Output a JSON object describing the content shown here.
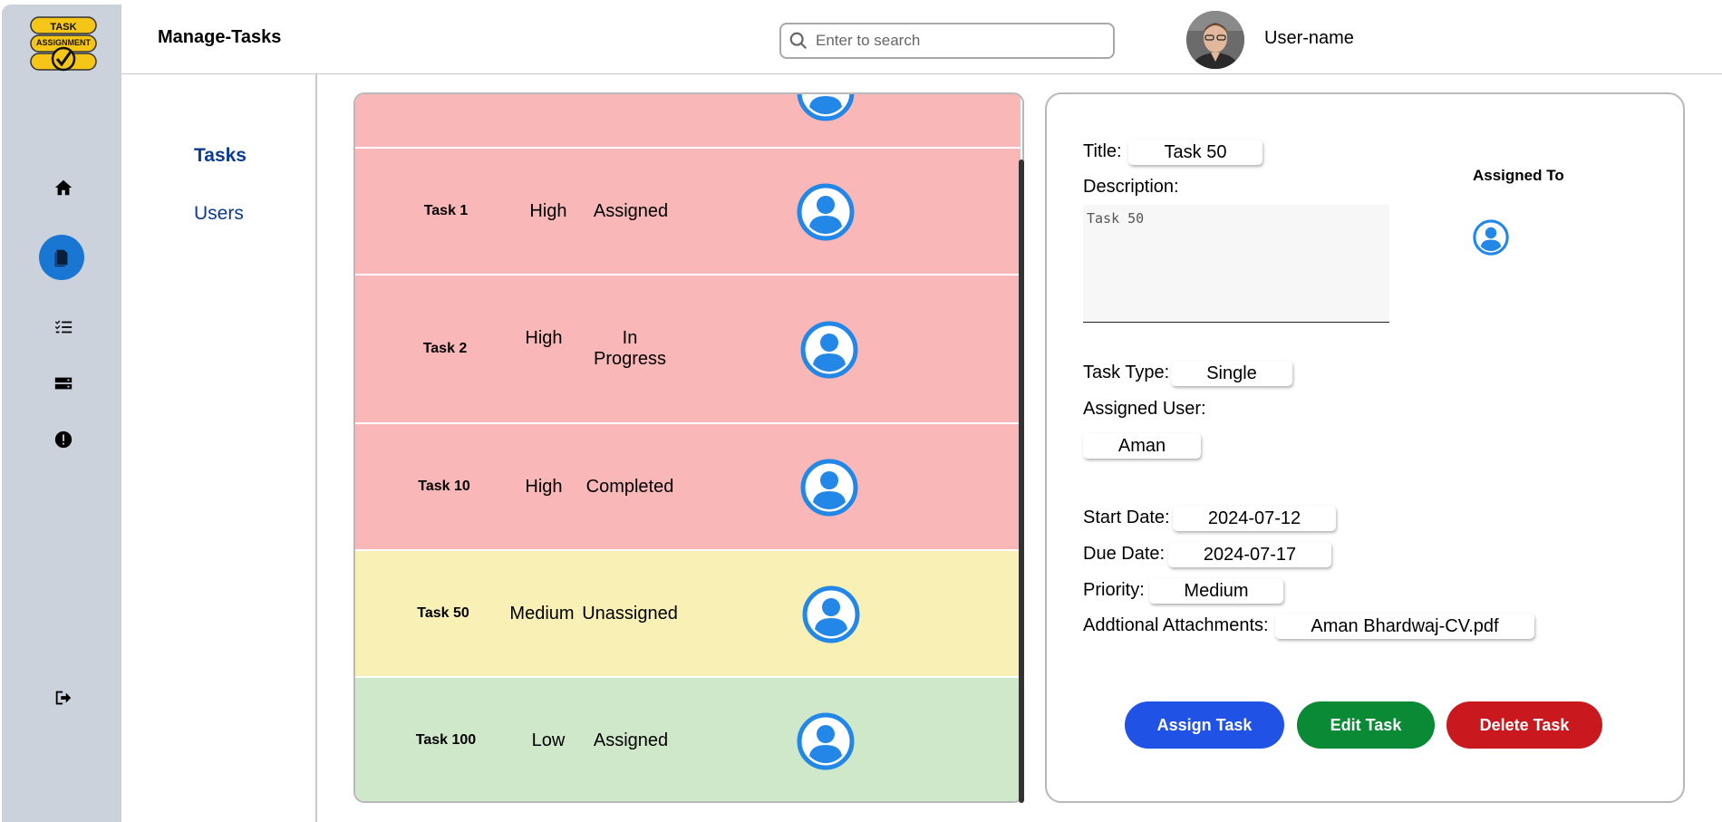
{
  "app": {
    "title": "Manage-Tasks",
    "logo_text": "TASK ASSIGNMENT"
  },
  "search": {
    "placeholder": "Enter to search",
    "value": ""
  },
  "user": {
    "name": "User-name"
  },
  "rail": {
    "icons": [
      "home-icon",
      "task-manage-icon",
      "checklist-icon",
      "storage-icon",
      "alert-icon",
      "logout-icon"
    ],
    "active": "task-manage-icon"
  },
  "subnav": {
    "items": [
      {
        "label": "Tasks",
        "active": true
      },
      {
        "label": "Users",
        "active": false
      }
    ]
  },
  "tasks": [
    {
      "name": "Task 1",
      "priority": "High",
      "status": "Assigned",
      "color": "#f9b7b7"
    },
    {
      "name": "Task 2",
      "priority": "High",
      "status": "In Progress",
      "color": "#f9b7b7"
    },
    {
      "name": "Task 10",
      "priority": "High",
      "status": "Completed",
      "color": "#f9b7b7"
    },
    {
      "name": "Task 50",
      "priority": "Medium",
      "status": "Unassigned",
      "color": "#f9f0b5"
    },
    {
      "name": "Task 100",
      "priority": "Low",
      "status": "Assigned",
      "color": "#cfe8c9"
    }
  ],
  "detail": {
    "title_label": "Title:",
    "title": "Task 50",
    "description_label": "Description:",
    "description": "Task 50",
    "assigned_to_label": "Assigned To",
    "task_type_label": "Task Type:",
    "task_type": "Single",
    "assigned_user_label": "Assigned User:",
    "assigned_user": "Aman",
    "start_date_label": "Start Date:",
    "start_date": "2024-07-12",
    "due_date_label": "Due Date:",
    "due_date": "2024-07-17",
    "priority_label": "Priority:",
    "priority": "Medium",
    "attachments_label": "Addtional Attachments:",
    "attachment": "Aman Bhardwaj-CV.pdf"
  },
  "actions": {
    "assign": {
      "label": "Assign Task",
      "color": "#2152e6"
    },
    "edit": {
      "label": "Edit Task",
      "color": "#0a8a35"
    },
    "delete": {
      "label": "Delete Task",
      "color": "#c9191f"
    }
  },
  "colors": {
    "rail_bg": "#cbd2dc",
    "accent": "#1976d2",
    "user_icon": "#2287e6",
    "nav_text": "#0d3c8c"
  }
}
